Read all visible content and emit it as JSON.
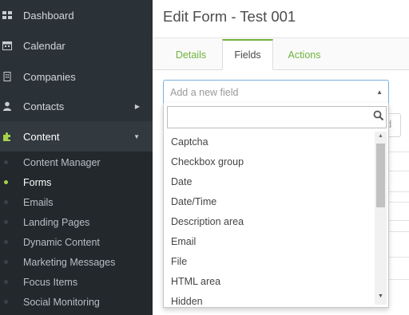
{
  "sidebar": {
    "items": [
      {
        "label": "Dashboard",
        "icon": "dashboard-icon"
      },
      {
        "label": "Calendar",
        "icon": "calendar-icon"
      },
      {
        "label": "Companies",
        "icon": "building-icon"
      },
      {
        "label": "Contacts",
        "icon": "user-icon"
      },
      {
        "label": "Content",
        "icon": "puzzle-icon"
      }
    ],
    "content_submenu": [
      {
        "label": "Content Manager"
      },
      {
        "label": "Forms",
        "active": true
      },
      {
        "label": "Emails"
      },
      {
        "label": "Landing Pages"
      },
      {
        "label": "Dynamic Content"
      },
      {
        "label": "Marketing Messages"
      },
      {
        "label": "Focus Items"
      },
      {
        "label": "Social Monitoring"
      }
    ]
  },
  "page": {
    "title": "Edit Form - Test 001",
    "tabs": [
      {
        "label": "Details"
      },
      {
        "label": "Fields",
        "active": true
      },
      {
        "label": "Actions"
      }
    ],
    "background_button_fragment": "d"
  },
  "field_select": {
    "placeholder": "Add a new field",
    "search_value": "",
    "options": [
      "Captcha",
      "Checkbox group",
      "Date",
      "Date/Time",
      "Description area",
      "Email",
      "File",
      "HTML area",
      "Hidden"
    ]
  },
  "colors": {
    "accent_green": "#72b33d",
    "sidebar_bg": "#2b3237",
    "focus_blue": "#79b0e0"
  }
}
